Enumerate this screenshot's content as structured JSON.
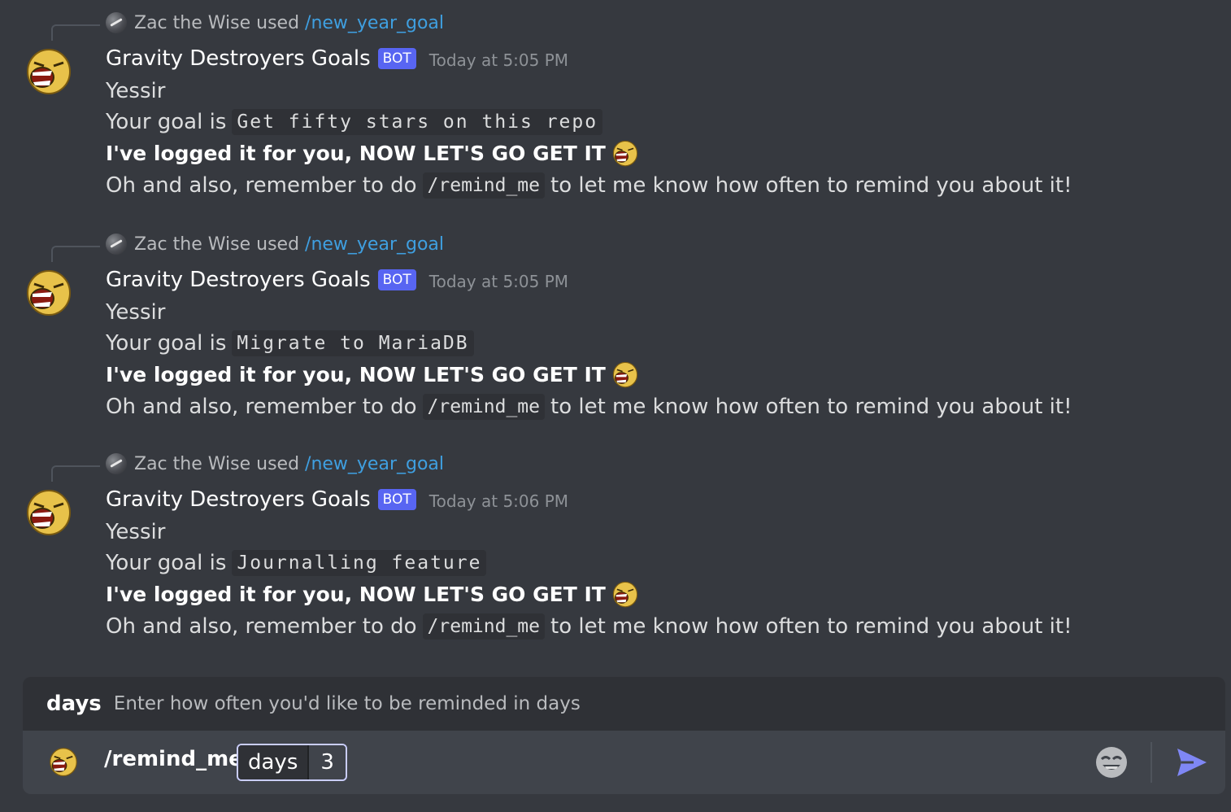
{
  "messages": [
    {
      "reply_user": "Zac the Wise",
      "reply_used": "used",
      "reply_command": "/new_year_goal",
      "author": "Gravity Destroyers Goals",
      "badge": "BOT",
      "timestamp": "Today at 5:05 PM",
      "greeting": "Yessir",
      "goal_prefix": "Your goal is",
      "goal": "Get fifty stars on this repo",
      "logged_text": "I've logged it for you, NOW LET'S GO GET IT",
      "remind_prefix": "Oh and also, remember to do",
      "remind_command": "/remind_me",
      "remind_suffix": "to let me know how often to remind you about it!"
    },
    {
      "reply_user": "Zac the Wise",
      "reply_used": "used",
      "reply_command": "/new_year_goal",
      "author": "Gravity Destroyers Goals",
      "badge": "BOT",
      "timestamp": "Today at 5:05 PM",
      "greeting": "Yessir",
      "goal_prefix": "Your goal is",
      "goal": "Migrate to MariaDB",
      "logged_text": "I've logged it for you, NOW LET'S GO GET IT",
      "remind_prefix": "Oh and also, remember to do",
      "remind_command": "/remind_me",
      "remind_suffix": "to let me know how often to remind you about it!"
    },
    {
      "reply_user": "Zac the Wise",
      "reply_used": "used",
      "reply_command": "/new_year_goal",
      "author": "Gravity Destroyers Goals",
      "badge": "BOT",
      "timestamp": "Today at 5:06 PM",
      "greeting": "Yessir",
      "goal_prefix": "Your goal is",
      "goal": "Journalling feature",
      "logged_text": "I've logged it for you, NOW LET'S GO GET IT",
      "remind_prefix": "Oh and also, remember to do",
      "remind_command": "/remind_me",
      "remind_suffix": "to let me know how often to remind you about it!"
    }
  ],
  "option_hint": {
    "name": "days",
    "description": "Enter how often you'd like to be reminded in days"
  },
  "composer": {
    "command": "/remind_me",
    "option_name": "days",
    "option_value": "3"
  },
  "colors": {
    "background": "#36393f",
    "bot_badge": "#5865f2",
    "command_link": "#3f9fe0"
  },
  "icons": {
    "bot_avatar": "screaming-face-icon",
    "reply_avatar": "galaxy-avatar-icon",
    "emoji_button": "emoji-icon",
    "send_button": "send-icon"
  }
}
